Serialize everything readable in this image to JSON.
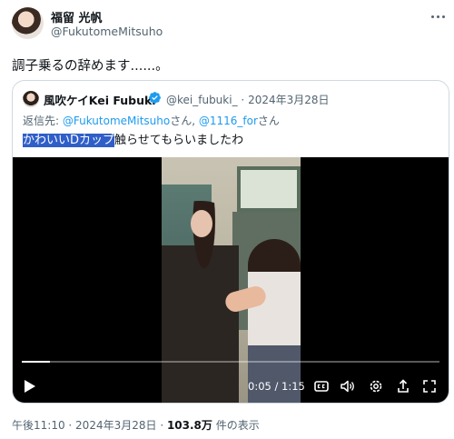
{
  "author": {
    "display_name": "福留 光帆",
    "handle": "@FukutomeMitsuho"
  },
  "tweet": {
    "text": "調子乗るの辞めます......。"
  },
  "quoted_tweet": {
    "display_name": "風吹ケイKei Fubuki",
    "handle": "@kei_fubuki_",
    "separator": "·",
    "date": "2024年3月28日",
    "reply_prefix": "返信先: ",
    "reply_to_1": "@FukutomeMitsuho",
    "reply_joiner_1": "さん, ",
    "reply_to_2": "@1116_for",
    "reply_joiner_2": "さん",
    "text_highlighted": "かわいいDカップ",
    "text_rest": "触らせてもらいましたわ"
  },
  "video": {
    "time_current": "0:05",
    "time_separator": " / ",
    "time_total": "1:15",
    "progress": 0.067
  },
  "footer": {
    "time": "午後11:10",
    "separator_1": " · ",
    "date": "2024年3月28日",
    "separator_2": " · ",
    "views_count": "103.8万",
    "views_label": " 件の表示"
  },
  "colors": {
    "accent": "#1d9bf0",
    "highlight": "#2f5ec8",
    "secondary_text": "#536471"
  },
  "icons": [
    "more-icon",
    "verified-badge-icon",
    "play-icon",
    "captions-icon",
    "volume-icon",
    "settings-icon",
    "share-icon",
    "fullscreen-icon"
  ]
}
